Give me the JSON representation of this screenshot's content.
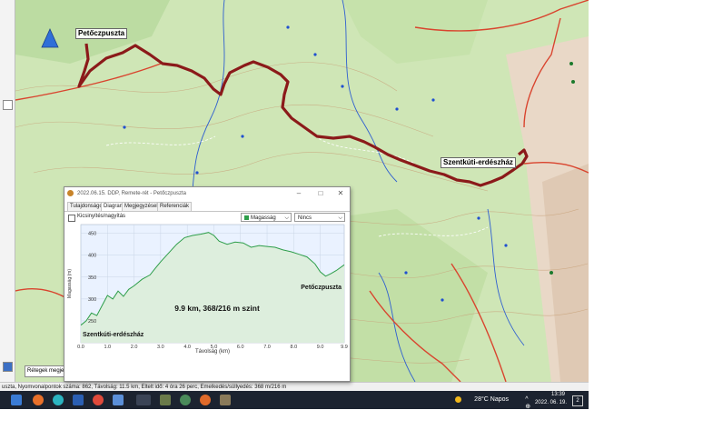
{
  "map": {
    "start_label": "Petőczpuszta",
    "end_label": "Szentkúti-erdészház",
    "route_color": "#8b1a1a",
    "background": "#cfe6b6",
    "layers_select": "Rétegek megjelenítése"
  },
  "statusbar": {
    "text": "uszta, Nyomvonalpontok száma: 862, Távolság: 11.5 km, Eltelt idő: 4 óra 26 perc, Emelkedés/süllyedés: 368 m/216 m"
  },
  "taskbar": {
    "weather": "28°C  Napos",
    "time": "13:39",
    "date": "2022. 06. 19.",
    "notifications": "2"
  },
  "dialog": {
    "title": "2022.06.15. DDP, Remete-rét - Petőczpuszta",
    "tabs": [
      "Tulajdonságok",
      "Diagram",
      "Megjegyzések",
      "Referenciák"
    ],
    "active_tab": 1,
    "zoom_checkbox": "Kicsinyítés/nagyítás",
    "series_select": "Magasság",
    "secondary_select": "Nincs"
  },
  "chart_data": {
    "type": "line",
    "title": "",
    "xlabel": "Távolság (km)",
    "ylabel": "Magasság (m)",
    "xlim": [
      0,
      9.9
    ],
    "ylim": [
      200,
      470
    ],
    "x_ticks": [
      "0.0",
      "1.0",
      "2.0",
      "3.0",
      "4.0",
      "5.0",
      "6.0",
      "7.0",
      "8.0",
      "9.0",
      "9.9"
    ],
    "y_ticks": [
      "250",
      "300",
      "350",
      "400",
      "450"
    ],
    "line_color": "#2e9e4a",
    "fill_color": "#ddeedd",
    "annotation": "9.9 km, 368/216 m szint",
    "start_label": "Szentkúti-erdészház",
    "end_label": "Petőczpuszta",
    "x": [
      0,
      0.2,
      0.4,
      0.6,
      0.8,
      1.0,
      1.2,
      1.4,
      1.6,
      1.8,
      2.0,
      2.3,
      2.6,
      2.8,
      3.0,
      3.3,
      3.6,
      3.9,
      4.2,
      4.5,
      4.8,
      5.0,
      5.2,
      5.5,
      5.8,
      6.1,
      6.4,
      6.7,
      7.0,
      7.3,
      7.6,
      7.9,
      8.2,
      8.5,
      8.8,
      9.0,
      9.2,
      9.4,
      9.6,
      9.9
    ],
    "y": [
      240,
      250,
      268,
      262,
      285,
      308,
      300,
      318,
      306,
      322,
      330,
      345,
      355,
      370,
      385,
      405,
      425,
      440,
      445,
      448,
      452,
      445,
      432,
      425,
      430,
      428,
      418,
      422,
      420,
      418,
      412,
      408,
      402,
      396,
      380,
      362,
      352,
      358,
      365,
      378
    ]
  }
}
